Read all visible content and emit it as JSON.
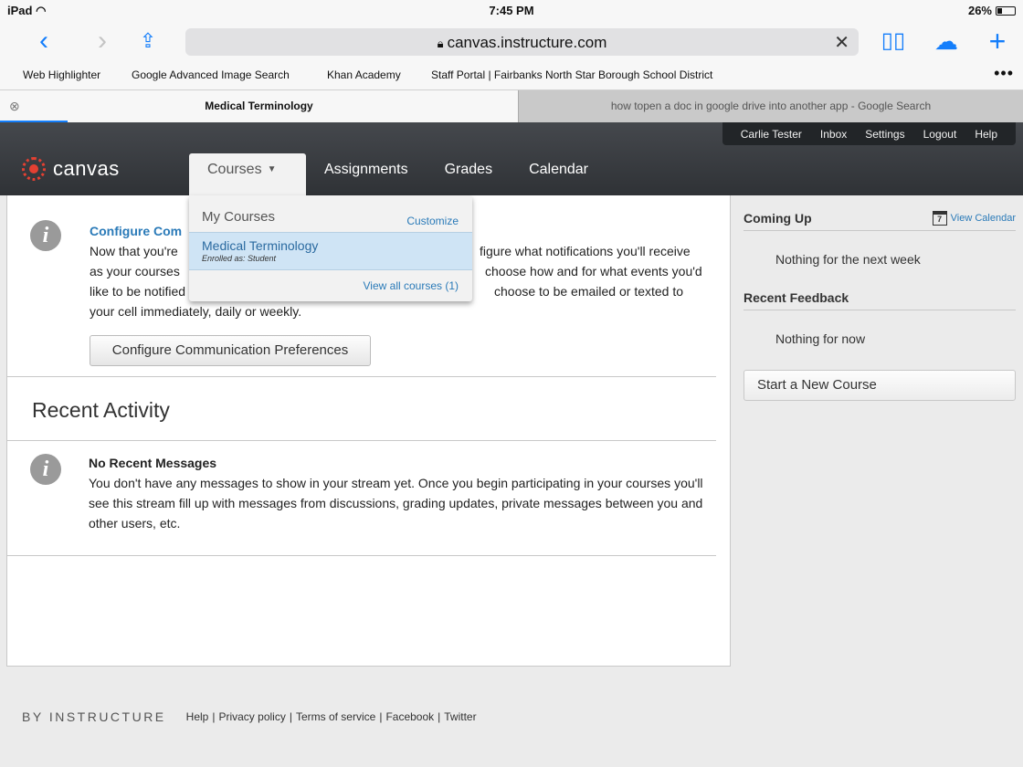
{
  "status_bar": {
    "device": "iPad",
    "time": "7:45 PM",
    "battery": "26%",
    "battery_level": 0.26
  },
  "safari": {
    "url": "canvas.instructure.com",
    "bookmarks": [
      "Web Highlighter",
      "Google Advanced Image Search",
      "Khan Academy",
      "Staff Portal | Fairbanks North Star Borough School District"
    ],
    "tabs": [
      {
        "label": "Medical Terminology",
        "active": true
      },
      {
        "label": "how topen a doc in google drive into another app - Google Search",
        "active": false
      }
    ]
  },
  "header": {
    "logo_text": "canvas",
    "user_nav": [
      "Carlie Tester",
      "Inbox",
      "Settings",
      "Logout",
      "Help"
    ],
    "nav": [
      "Courses",
      "Assignments",
      "Grades",
      "Calendar"
    ]
  },
  "dropdown": {
    "heading": "My Courses",
    "customize": "Customize",
    "course_name": "Medical Terminology",
    "enrolled": "Enrolled as: Student",
    "view_all": "View all courses (1)"
  },
  "main": {
    "configure": {
      "title": "Configure Com",
      "body_line1_a": "Now that you're",
      "body_line1_b": "figure what notifications you'll receive",
      "body_line2_a": "as your courses",
      "body_line2_b": "choose how and for what events you'd",
      "body_line3_a": "like to be notified",
      "body_line3_b": "choose to be emailed or texted to",
      "body_line4": "your cell immediately, daily or weekly.",
      "button": "Configure Communication Preferences"
    },
    "recent_activity_title": "Recent Activity",
    "no_messages": {
      "title": "No Recent Messages",
      "body": "You don't have any messages to show in your stream yet. Once you begin participating in your courses you'll see this stream fill up with messages from discussions, grading updates, private messages between you and other users, etc."
    }
  },
  "sidebar": {
    "coming_up": "Coming Up",
    "view_calendar": "View Calendar",
    "calendar_day": "7",
    "coming_up_text": "Nothing for the next week",
    "recent_feedback": "Recent Feedback",
    "recent_feedback_text": "Nothing for now",
    "new_course_button": "Start a New Course"
  },
  "footer": {
    "brand": "BY INSTRUCTURE",
    "links": [
      "Help",
      "Privacy policy",
      "Terms of service",
      "Facebook",
      "Twitter"
    ]
  },
  "colors": {
    "link": "#2a7ab8",
    "ios_blue": "#147efb",
    "header_bg": "#3c3f44",
    "logo_red": "#e44032"
  }
}
